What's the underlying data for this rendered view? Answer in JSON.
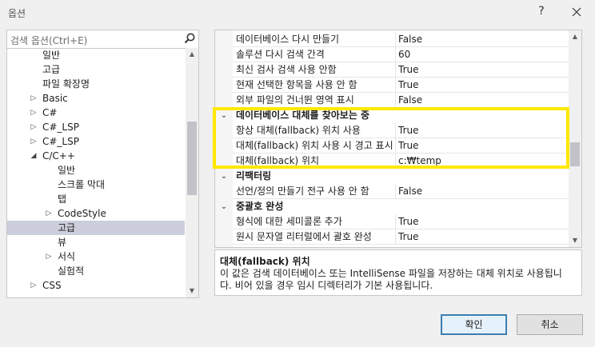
{
  "window": {
    "title": "옵션",
    "help": "?"
  },
  "search": {
    "placeholder": "검색 옵션(Ctrl+E)"
  },
  "tree": [
    {
      "label": "일반",
      "indent": 2,
      "arrow": ""
    },
    {
      "label": "고급",
      "indent": 2,
      "arrow": ""
    },
    {
      "label": "파일 확장명",
      "indent": 2,
      "arrow": ""
    },
    {
      "label": "Basic",
      "indent": 2,
      "arrow": "▷"
    },
    {
      "label": "C#",
      "indent": 2,
      "arrow": "▷"
    },
    {
      "label": "C#_LSP",
      "indent": 2,
      "arrow": "▷"
    },
    {
      "label": "C#_LSP",
      "indent": 2,
      "arrow": "▷"
    },
    {
      "label": "C/C++",
      "indent": 2,
      "arrow": "◢"
    },
    {
      "label": "일반",
      "indent": 3,
      "arrow": ""
    },
    {
      "label": "스크롤 막대",
      "indent": 3,
      "arrow": ""
    },
    {
      "label": "탭",
      "indent": 3,
      "arrow": ""
    },
    {
      "label": "CodeStyle",
      "indent": 3,
      "arrow": "▷"
    },
    {
      "label": "고급",
      "indent": 3,
      "arrow": "",
      "selected": true
    },
    {
      "label": "뷰",
      "indent": 3,
      "arrow": ""
    },
    {
      "label": "서식",
      "indent": 3,
      "arrow": "▷"
    },
    {
      "label": "실험적",
      "indent": 3,
      "arrow": ""
    },
    {
      "label": "CSS",
      "indent": 2,
      "arrow": "▷"
    }
  ],
  "grid": [
    {
      "kind": "prop",
      "name": "데이터베이스 다시 만들기",
      "value": "False"
    },
    {
      "kind": "prop",
      "name": "솔루션 다시 검색 간격",
      "value": "60"
    },
    {
      "kind": "prop",
      "name": "최신 검사 검색 사용 안함",
      "value": "True"
    },
    {
      "kind": "prop",
      "name": "현재 선택한 항목을 사용 안 함",
      "value": "True"
    },
    {
      "kind": "prop",
      "name": "외부 파일의 건너뛴 영역 표시",
      "value": "False"
    },
    {
      "kind": "cat",
      "name": "데이터베이스 대체를 찾아보는 중"
    },
    {
      "kind": "prop",
      "name": "항상 대체(fallback) 위치 사용",
      "value": "True"
    },
    {
      "kind": "prop",
      "name": "대체(fallback) 위치 사용 시 경고 표시",
      "value": "True"
    },
    {
      "kind": "prop",
      "name": "대체(fallback) 위치",
      "value": "c:₩temp"
    },
    {
      "kind": "cat",
      "name": "리팩터링"
    },
    {
      "kind": "prop",
      "name": "선언/정의 만들기 전구 사용 안 함",
      "value": "False"
    },
    {
      "kind": "cat",
      "name": "중괄호 완성"
    },
    {
      "kind": "prop",
      "name": "형식에 대한 세미콜론 추가",
      "value": "True"
    },
    {
      "kind": "prop",
      "name": "원시 문자열 리터럴에서 괄호 완성",
      "value": "True"
    }
  ],
  "description": {
    "title": "대체(fallback) 위치",
    "line1": "이 값은 검색 데이터베이스 또는 IntelliSense 파일을 저장하는 대체 위치로 사용됩니",
    "line2": "다. 비어 있을 경우 임시 디렉터리가 기본 사용됩니다."
  },
  "buttons": {
    "ok": "확인",
    "cancel": "취소"
  },
  "colors": {
    "highlight": "#ffe800",
    "selection": "#cccedb",
    "ok_border": "#3c7fb1"
  }
}
